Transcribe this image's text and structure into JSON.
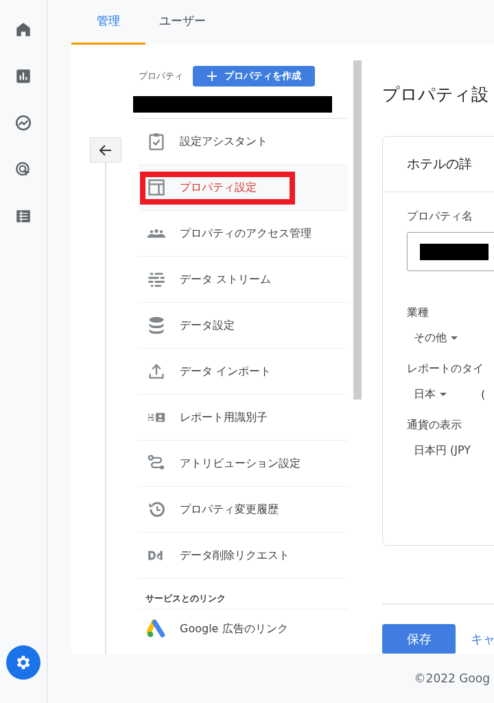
{
  "rail": {
    "items": [
      {
        "kind": "home"
      },
      {
        "kind": "reports"
      },
      {
        "kind": "explore"
      },
      {
        "kind": "advertising"
      },
      {
        "kind": "configure"
      }
    ],
    "settings": {
      "selected": true
    }
  },
  "tabs": [
    {
      "label": "管理",
      "selected": true
    },
    {
      "label": "ユーザー",
      "selected": false
    }
  ],
  "nav": {
    "label": "プロパティ",
    "create_button": "プロパティを作成",
    "items": [
      {
        "label": "設定アシスタント",
        "kind": "assistant",
        "selected": false,
        "highlighted": false
      },
      {
        "label": "プロパティ設定",
        "kind": "property",
        "selected": true,
        "highlighted": true
      },
      {
        "label": "プロパティのアクセス管理",
        "kind": "people",
        "selected": false,
        "highlighted": false
      },
      {
        "label": "データ ストリーム",
        "kind": "streams",
        "selected": false,
        "highlighted": false
      },
      {
        "label": "データ設定",
        "kind": "database",
        "selected": false,
        "highlighted": false
      },
      {
        "label": "データ インポート",
        "kind": "upload",
        "selected": false,
        "highlighted": false
      },
      {
        "label": "レポート用識別子",
        "kind": "identity",
        "selected": false,
        "highlighted": false
      },
      {
        "label": "アトリビューション設定",
        "kind": "route",
        "selected": false,
        "highlighted": false
      },
      {
        "label": "プロパティ変更履歴",
        "kind": "history",
        "selected": false,
        "highlighted": false
      },
      {
        "label": "データ削除リクエスト",
        "kind": "dd",
        "selected": false,
        "highlighted": false
      }
    ],
    "section": {
      "title": "サービスとのリンク",
      "items": [
        {
          "label": "Google 広告のリンク",
          "kind": "ads"
        }
      ]
    }
  },
  "detail": {
    "title": "プロパティ設",
    "card_title": "ホテルの詳",
    "fields": [
      {
        "label": "プロパティ名",
        "kind": "input"
      },
      {
        "label": "業種",
        "kind": "select",
        "values": [
          "その他"
        ]
      },
      {
        "label": "レポートのタイ",
        "kind": "select",
        "values": [
          "日本",
          "("
        ]
      },
      {
        "label": "通貨の表示",
        "kind": "text",
        "values": [
          "日本円 (JPY"
        ]
      }
    ],
    "save_button": "保存",
    "cancel_link": "キャ"
  },
  "footer": "©2022 Goog"
}
